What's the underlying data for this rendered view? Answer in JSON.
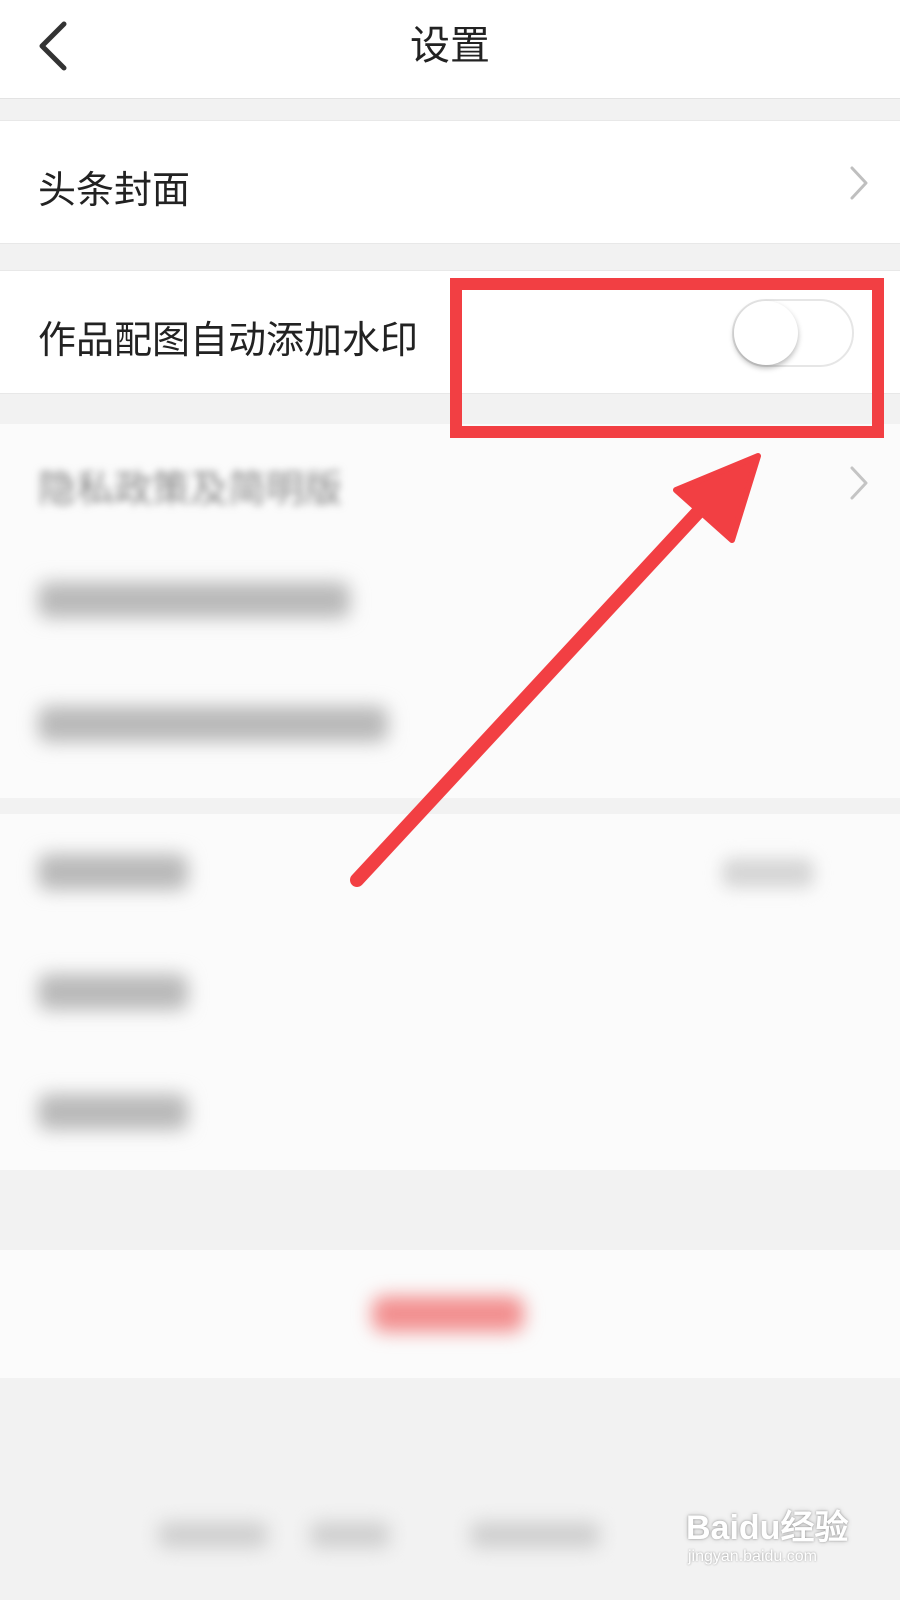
{
  "header": {
    "title": "设置",
    "back_icon": "chevron-left-icon"
  },
  "settings": {
    "cover_label": "头条封面",
    "watermark_label": "作品配图自动添加水印",
    "watermark_toggle_on": false,
    "privacy_label": "隐私政策及简明版"
  },
  "annotation": {
    "color": "#f23f43"
  },
  "watermark": {
    "logo_text": "Baidu经验",
    "url_text": "jingyan.baidu.com"
  }
}
